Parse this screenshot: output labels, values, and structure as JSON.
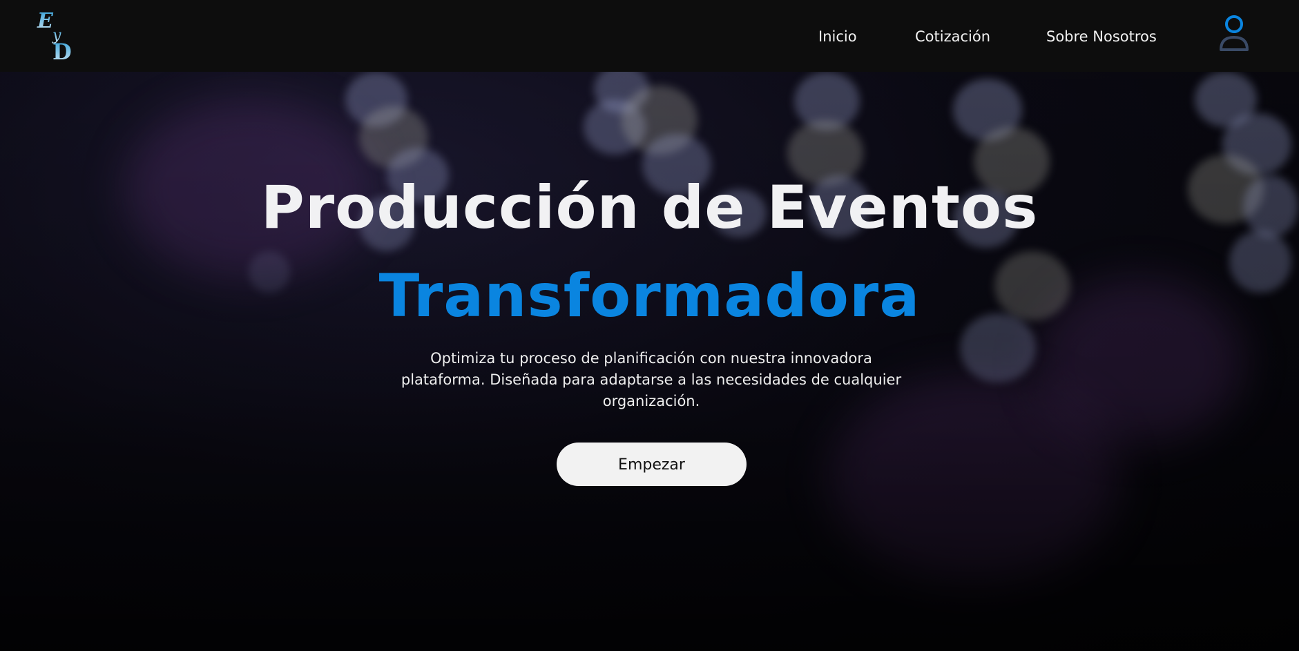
{
  "brand": {
    "logo_text": "EyD"
  },
  "nav": {
    "items": [
      {
        "label": "Inicio"
      },
      {
        "label": "Cotización"
      },
      {
        "label": "Sobre Nosotros"
      }
    ]
  },
  "hero": {
    "title": "Producción de Eventos",
    "title_accent": "Transformadora",
    "description": "Optimiza tu proceso de planificación con nuestra innovadora plataforma. Diseñada para adaptarse a las necesidades de cualquier organización.",
    "cta_label": "Empezar"
  },
  "colors": {
    "accent": "#0a85e0",
    "navbar_bg": "#0d0d0d",
    "button_bg": "#f2f2f2"
  },
  "icons": {
    "user": "user-icon",
    "logo": "logo-monogram"
  }
}
